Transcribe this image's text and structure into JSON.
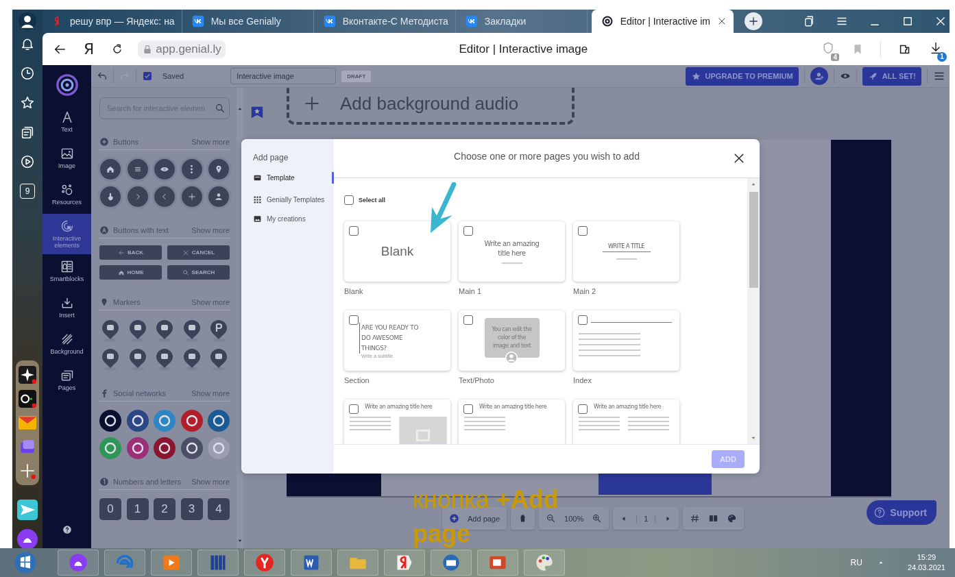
{
  "browser": {
    "tabs": [
      {
        "title": "решу впр — Яндекс: на",
        "selected": false
      },
      {
        "title": "Мы все Genially",
        "selected": false
      },
      {
        "title": "Вконтакте-С Методиста",
        "selected": false
      },
      {
        "title": "Закладки",
        "selected": false
      },
      {
        "title": "Editor | Interactive im",
        "selected": true
      }
    ],
    "sidebar_badge": "9",
    "home_letter": "Я",
    "address": "app.genial.ly",
    "page_title": "Editor | Interactive image",
    "protect_count": "4",
    "download_count": "1"
  },
  "toolbar": {
    "status": "Saved",
    "title": "Interactive image",
    "badge": "DRAFT",
    "upgrade": "UPGRADE TO PREMIUM",
    "publish": "ALL SET!"
  },
  "nav": [
    {
      "label": "Text",
      "selected": false
    },
    {
      "label": "Image",
      "selected": false
    },
    {
      "label": "Resources",
      "selected": false
    },
    {
      "label": "Interactive elements",
      "selected": true
    },
    {
      "label": "Smartblocks",
      "selected": false
    },
    {
      "label": "Insert",
      "selected": false
    },
    {
      "label": "Background",
      "selected": false
    },
    {
      "label": "Pages",
      "selected": false
    }
  ],
  "panel": {
    "search_placeholder": "Search for interactive elemen",
    "sections": [
      {
        "kind": "icon_buttons",
        "title": "Buttons",
        "more": "Show more"
      },
      {
        "kind": "text_buttons",
        "title": "Buttons with text",
        "more": "Show more",
        "items": [
          "BACK",
          "CANCEL",
          "HOME",
          "SEARCH"
        ]
      },
      {
        "kind": "markers",
        "title": "Markers",
        "more": "Show more"
      },
      {
        "kind": "social",
        "title": "Social networks",
        "more": "Show more",
        "items": [
          {
            "color": "#0b1230"
          },
          {
            "color": "#2c4785"
          },
          {
            "color": "#2d86c2"
          },
          {
            "color": "#b01f2b"
          },
          {
            "color": "#1b5b94"
          },
          {
            "color": "#2f9657"
          },
          {
            "color": "#9c2f78"
          },
          {
            "color": "#8a1631"
          },
          {
            "color": "#4a4f66"
          },
          {
            "color": "#9a9eb1"
          }
        ]
      },
      {
        "kind": "numbers",
        "title": "Numbers and letters",
        "more": "Show more",
        "items": [
          "0",
          "1",
          "2",
          "3",
          "4"
        ]
      }
    ]
  },
  "canvas": {
    "audio_label": "Add background audio",
    "add_page": "Add page",
    "zoom": "100%",
    "page": "1",
    "support": "Support"
  },
  "modal": {
    "sidebar_title": "Add page",
    "menu": [
      {
        "label": "Template",
        "selected": true
      },
      {
        "label": "Genially Templates",
        "selected": false
      },
      {
        "label": "My creations",
        "selected": false
      }
    ],
    "heading": "Choose one or more pages you wish to add",
    "select_all": {
      "label": "Select all",
      "checked": false
    },
    "templates": [
      {
        "kind": "blank",
        "name": "Blank",
        "checked": false,
        "lines": [
          "Blank"
        ]
      },
      {
        "kind": "title",
        "name": "Main 1",
        "checked": false,
        "lines": [
          "Write an amazing title here"
        ]
      },
      {
        "kind": "title_line",
        "name": "Main 2",
        "checked": false,
        "lines": [
          "WRITE A TITLE"
        ]
      },
      {
        "kind": "section",
        "name": "Section",
        "checked": false,
        "lines": [
          "ARE YOU READY TO DO AWESOME THINGS?",
          "Write a subtitle"
        ]
      },
      {
        "kind": "quote",
        "name": "Text/Photo",
        "checked": false,
        "lines": [
          "You can edit the color of the image and text"
        ]
      },
      {
        "kind": "index",
        "name": "Index",
        "checked": false
      },
      {
        "kind": "image_text",
        "checked": false,
        "lines": [
          "Write an amazing title here"
        ]
      },
      {
        "kind": "text",
        "checked": false,
        "lines": [
          "Write an amazing title here"
        ]
      },
      {
        "kind": "two_columns",
        "checked": false,
        "lines": [
          "Write an amazing title here"
        ]
      }
    ],
    "add_button": "ADD"
  },
  "annotation": {
    "lines": [
      "кнопка **+Add**",
      "**page**"
    ]
  },
  "taskbar": {
    "language": "RU",
    "time": "15:29",
    "date": "24.03.2021"
  }
}
